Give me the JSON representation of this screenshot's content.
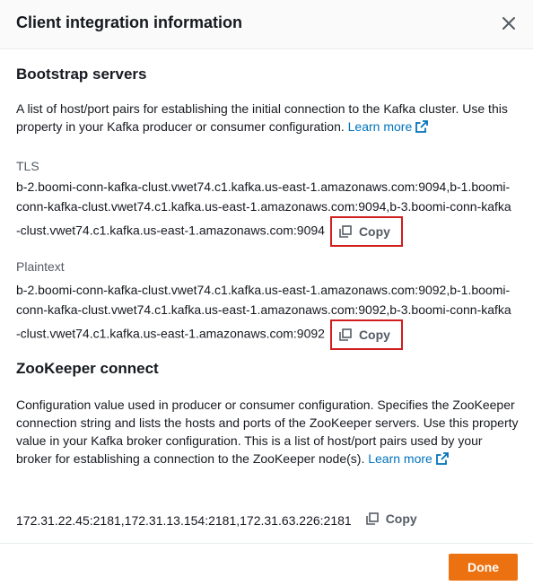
{
  "modal": {
    "title": "Client integration information",
    "done_label": "Done"
  },
  "bootstrap": {
    "heading": "Bootstrap servers",
    "description": "A list of host/port pairs for establishing the initial connection to the Kafka cluster. Use this property in your Kafka producer or consumer configuration.",
    "learn_more": "Learn more",
    "tls_label": "TLS",
    "tls_value": "b-2.boomi-conn-kafka-clust.vwet74.c1.kafka.us-east-1.amazonaws.com:9094,b-1.boomi-conn-kafka-clust.vwet74.c1.kafka.us-east-1.amazonaws.com:9094,b-3.boomi-conn-kafka-clust.vwet74.c1.kafka.us-east-1.amazonaws.com:9094",
    "plaintext_label": "Plaintext",
    "plaintext_value": "b-2.boomi-conn-kafka-clust.vwet74.c1.kafka.us-east-1.amazonaws.com:9092,b-1.boomi-conn-kafka-clust.vwet74.c1.kafka.us-east-1.amazonaws.com:9092,b-3.boomi-conn-kafka-clust.vwet74.c1.kafka.us-east-1.amazonaws.com:9092",
    "copy_label": "Copy"
  },
  "zookeeper": {
    "heading": "ZooKeeper connect",
    "description": "Configuration value used in producer or consumer configuration. Specifies the ZooKeeper connection string and lists the hosts and ports of the ZooKeeper servers. Use this property value in your Kafka broker configuration. This is a list of host/port pairs used by your broker for establishing a connection to the ZooKeeper node(s).",
    "learn_more": "Learn more",
    "value": "172.31.22.45:2181,172.31.13.154:2181,172.31.63.226:2181",
    "copy_label": "Copy"
  },
  "colors": {
    "primary_button": "#ec7211",
    "link": "#0073bb",
    "highlight": "#d11d1d"
  }
}
